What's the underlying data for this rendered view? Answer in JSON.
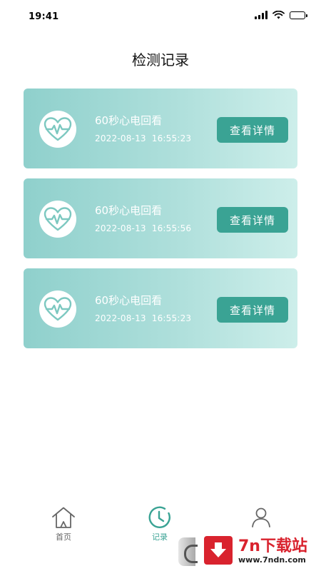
{
  "status_bar": {
    "time": "19:41",
    "icons": [
      "signal-icon",
      "wifi-icon",
      "battery-icon"
    ]
  },
  "header": {
    "title": "检测记录"
  },
  "records": [
    {
      "title": "60秒心电回看",
      "timestamp": "2022-08-13  16:55:23",
      "action_label": "查看详情",
      "icon": "heart-ecg-icon"
    },
    {
      "title": "60秒心电回看",
      "timestamp": "2022-08-13  16:55:56",
      "action_label": "查看详情",
      "icon": "heart-ecg-icon"
    },
    {
      "title": "60秒心电回看",
      "timestamp": "2022-08-13  16:55:23",
      "action_label": "查看详情",
      "icon": "heart-ecg-icon"
    }
  ],
  "tab_bar": {
    "tabs": [
      {
        "label": "首页",
        "icon": "home-icon",
        "active": false
      },
      {
        "label": "记录",
        "icon": "clock-icon",
        "active": true
      },
      {
        "label": "",
        "icon": "user-icon",
        "active": false
      }
    ]
  },
  "watermark": {
    "brand": "7n下载站",
    "url": "www.7ndn.com"
  },
  "colors": {
    "accent": "#3aa394",
    "card_gradient_start": "#8fd0cc",
    "card_gradient_end": "#cdeeea",
    "watermark_red": "#d9232e"
  }
}
